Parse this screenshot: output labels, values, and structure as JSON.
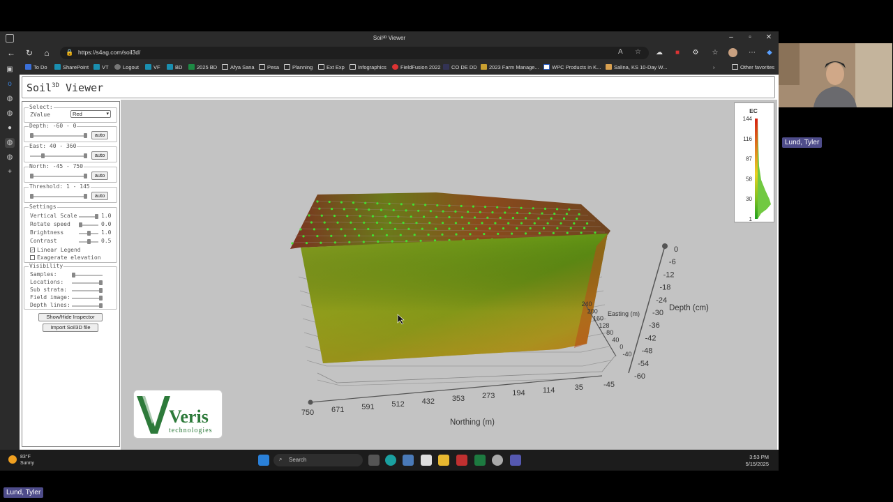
{
  "window": {
    "title": "Soil³ᴰ Viewer",
    "url": "https://s4ag.com/soil3d/"
  },
  "favorites": {
    "items": [
      "To Do",
      "SharePoint",
      "VT",
      "Logout",
      "VF",
      "BD",
      "2025 BD",
      "Afya Sana",
      "Pesa",
      "Planning",
      "Ext Exp",
      "Infographics",
      "FieldFusion 2022",
      "CO DE DD",
      "2023 Farm Manage...",
      "WPC Products in K...",
      "Salina, KS 10-Day W..."
    ],
    "other": "Other favorites"
  },
  "app": {
    "title_main": "Soil",
    "title_sup": "3D",
    "title_rest": " Viewer"
  },
  "panel": {
    "select_legend": "Select:",
    "zvalue_label": "ZValue",
    "zvalue_selected": "Red",
    "depth_legend": "Depth: -60 - 0",
    "east_legend": "East: 40 - 360",
    "north_legend": "North: -45 - 750",
    "threshold_legend": "Threshold: 1 - 145",
    "auto_label": "auto",
    "settings_legend": "Settings",
    "vertical_scale": "Vertical Scale",
    "vertical_scale_val": "1.0",
    "rotate_speed": "Rotate speed",
    "rotate_speed_val": "0.0",
    "brightness": "Brightness",
    "brightness_val": "1.0",
    "contrast": "Contrast",
    "contrast_val": "0.5",
    "linear_legend": "Linear Legend",
    "exaggerate": "Exagerate elevation",
    "visibility_legend": "Visibility",
    "samples": "Samples:",
    "locations": "Locations:",
    "sub_strata": "Sub strata:",
    "field_image": "Field image:",
    "depth_lines": "Depth lines:",
    "inspector_btn": "Show/Hide Inspector",
    "import_btn": "Import Soil3D file"
  },
  "viewer": {
    "northing_ticks": [
      "750",
      "671",
      "591",
      "512",
      "432",
      "353",
      "273",
      "194",
      "114",
      "35",
      "-45"
    ],
    "northing_label": "Northing (m)",
    "easting_ticks": [
      "240",
      "200",
      "160",
      "128",
      "80",
      "40",
      "0",
      "-40"
    ],
    "easting_label": "Easting (m)",
    "depth_ticks": [
      "0",
      "-6",
      "-12",
      "-18",
      "-24",
      "-30",
      "-36",
      "-42",
      "-48",
      "-54",
      "-60"
    ],
    "depth_label": "Depth (cm)",
    "legend_title": "EC",
    "legend_ticks": [
      "144",
      "116",
      "87",
      "58",
      "30",
      "1"
    ],
    "logo_main": "Veris",
    "logo_sub": "technologies"
  },
  "taskbar": {
    "temp": "83°F",
    "weather": "Sunny",
    "search": "Search",
    "time": "3:53 PM",
    "date": "5/15/2025"
  },
  "participants": {
    "top": "Lund, Tyler",
    "bottom": "Lund, Tyler"
  }
}
